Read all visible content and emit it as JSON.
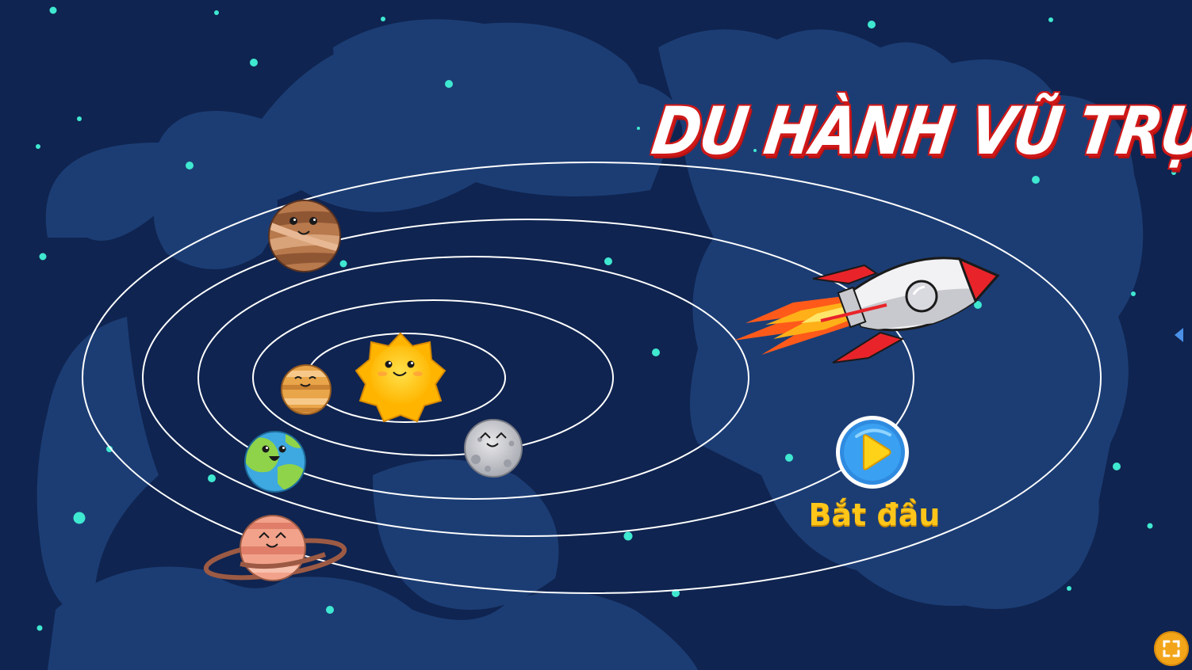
{
  "title": "DU HÀNH VŨ TRỤ",
  "start_button": {
    "label": "Bắt đầu",
    "icon": "play-icon"
  },
  "side_nav": {
    "icon": "triangle-left-icon"
  },
  "fullscreen": {
    "icon": "fullscreen-icon"
  },
  "colors": {
    "background": "#0f2450",
    "cloud": "#1c3d74",
    "orbit": "#ffffff",
    "star": "#3fe8d0",
    "title_outline": "#d01818",
    "start_label": "#ffc61a",
    "play_button": "#2f8be0"
  },
  "planets": [
    "jupiter",
    "sun",
    "venus",
    "moon",
    "earth",
    "saturn"
  ]
}
